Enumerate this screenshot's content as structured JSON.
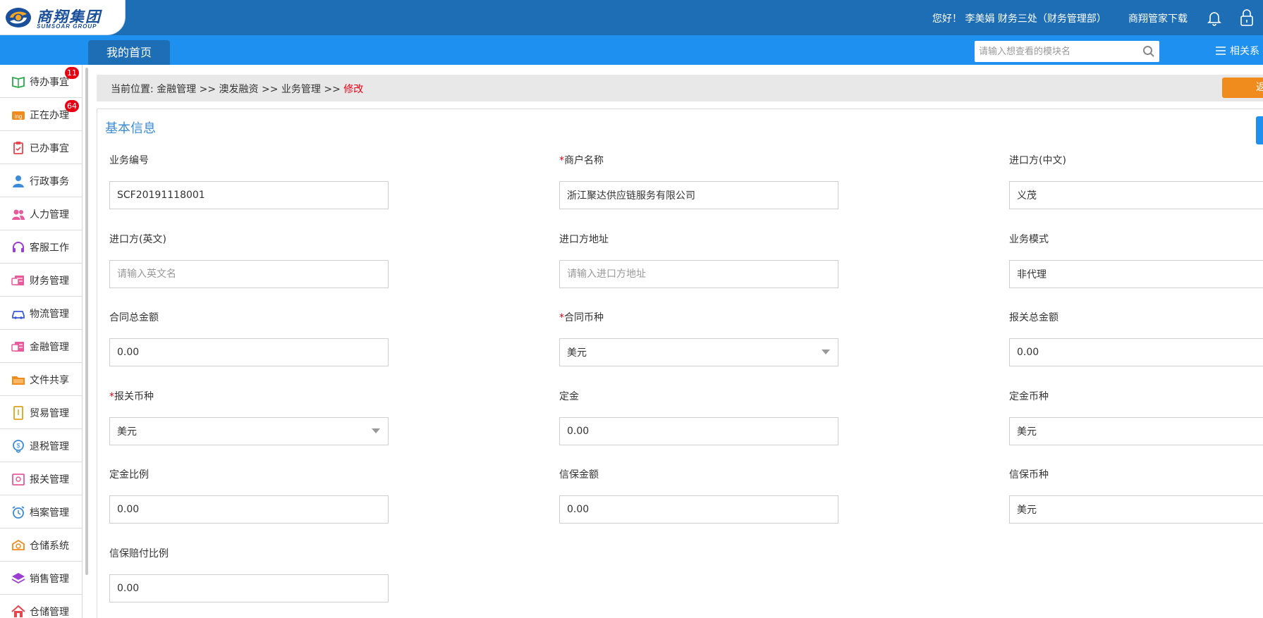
{
  "header": {
    "logo_cn": "商翔集团",
    "logo_en": "SUMSOAR GROUP",
    "greeting": "您好！ 李美娟 财务三处（财务管理部）",
    "download": "商翔管家下载",
    "bell_icon": "bell-icon",
    "lock_icon": "lock-icon",
    "brand_color": "#1e6eb5"
  },
  "nav": {
    "home_tab": "我的首页",
    "search_placeholder": "请输入想查看的模块名",
    "related": "相关系",
    "bar_color": "#1e90f0"
  },
  "sidebar": {
    "items": [
      {
        "label": "待办事宜",
        "icon": "book-icon",
        "badge": "11"
      },
      {
        "label": "正在办理",
        "icon": "ing-icon",
        "badge": "64"
      },
      {
        "label": "已办事宜",
        "icon": "clipboard-icon",
        "badge": ""
      },
      {
        "label": "行政事务",
        "icon": "person-icon",
        "badge": ""
      },
      {
        "label": "人力管理",
        "icon": "people-icon",
        "badge": ""
      },
      {
        "label": "客服工作",
        "icon": "headset-icon",
        "badge": ""
      },
      {
        "label": "财务管理",
        "icon": "finance-icon",
        "badge": ""
      },
      {
        "label": "物流管理",
        "icon": "car-icon",
        "badge": ""
      },
      {
        "label": "金融管理",
        "icon": "money-icon",
        "badge": ""
      },
      {
        "label": "文件共享",
        "icon": "folder-icon",
        "badge": ""
      },
      {
        "label": "贸易管理",
        "icon": "document-icon",
        "badge": ""
      },
      {
        "label": "退税管理",
        "icon": "refund-icon",
        "badge": ""
      },
      {
        "label": "报关管理",
        "icon": "customs-icon",
        "badge": ""
      },
      {
        "label": "档案管理",
        "icon": "alarm-clock-icon",
        "badge": ""
      },
      {
        "label": "仓储系统",
        "icon": "storage-icon",
        "badge": ""
      },
      {
        "label": "销售管理",
        "icon": "layers-icon",
        "badge": ""
      },
      {
        "label": "仓储管理",
        "icon": "house-icon",
        "badge": ""
      }
    ]
  },
  "breadcrumb": {
    "prefix": "当前位置: 金融管理 >> 澳发融资 >> 业务管理 >> ",
    "current": "修改",
    "action": "返回",
    "action_color": "#f08b1d"
  },
  "form": {
    "title": "基本信息",
    "fields": [
      {
        "label": "业务编号",
        "required": false,
        "value": "SCF20191118001",
        "placeholder": "",
        "type": "text"
      },
      {
        "label": "商户名称",
        "required": true,
        "value": "浙江聚达供应链服务有限公司",
        "placeholder": "",
        "type": "text"
      },
      {
        "label": "进口方(中文)",
        "required": false,
        "value": "义茂",
        "placeholder": "",
        "type": "text"
      },
      {
        "label": "进口方(英文)",
        "required": false,
        "value": "",
        "placeholder": "请输入英文名",
        "type": "text"
      },
      {
        "label": "进口方地址",
        "required": false,
        "value": "",
        "placeholder": "请输入进口方地址",
        "type": "text"
      },
      {
        "label": "业务模式",
        "required": false,
        "value": "非代理",
        "placeholder": "",
        "type": "text"
      },
      {
        "label": "合同总金额",
        "required": false,
        "value": "0.00",
        "placeholder": "",
        "type": "text"
      },
      {
        "label": "合同币种",
        "required": true,
        "value": "美元",
        "placeholder": "",
        "type": "select"
      },
      {
        "label": "报关总金额",
        "required": false,
        "value": "0.00",
        "placeholder": "",
        "type": "text"
      },
      {
        "label": "报关币种",
        "required": true,
        "value": "美元",
        "placeholder": "",
        "type": "select"
      },
      {
        "label": "定金",
        "required": false,
        "value": "0.00",
        "placeholder": "",
        "type": "text"
      },
      {
        "label": "定金币种",
        "required": false,
        "value": "美元",
        "placeholder": "",
        "type": "text"
      },
      {
        "label": "定金比例",
        "required": false,
        "value": "0.00",
        "placeholder": "",
        "type": "text"
      },
      {
        "label": "信保金额",
        "required": false,
        "value": "0.00",
        "placeholder": "",
        "type": "text"
      },
      {
        "label": "信保币种",
        "required": false,
        "value": "美元",
        "placeholder": "",
        "type": "text"
      },
      {
        "label": "信保赔付比例",
        "required": false,
        "value": "0.00",
        "placeholder": "",
        "type": "text"
      }
    ],
    "required_mark": "*"
  }
}
